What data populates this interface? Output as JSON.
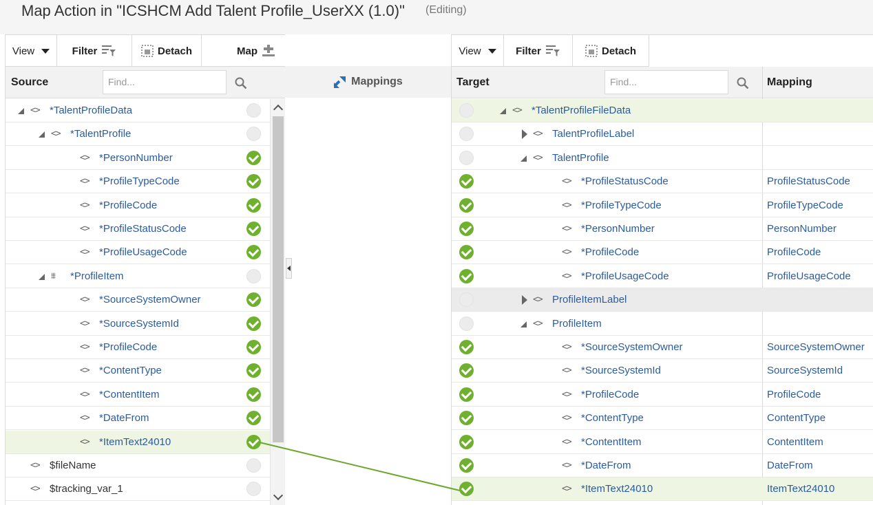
{
  "header": {
    "title": "Map Action in \"ICSHCM Add Talent Profile_UserXX (1.0)\"",
    "status": "(Editing)"
  },
  "source": {
    "toolbar": {
      "view": "View",
      "filter": "Filter",
      "detach": "Detach",
      "map": "Map"
    },
    "column_label": "Source",
    "find_placeholder": "Find...",
    "rows": [
      {
        "label": "*TalentProfileData",
        "status": "empty"
      },
      {
        "label": "*TalentProfile",
        "status": "empty"
      },
      {
        "label": "*PersonNumber",
        "status": "ok"
      },
      {
        "label": "*ProfileTypeCode",
        "status": "ok"
      },
      {
        "label": "*ProfileCode",
        "status": "ok"
      },
      {
        "label": "*ProfileStatusCode",
        "status": "ok"
      },
      {
        "label": "*ProfileUsageCode",
        "status": "ok"
      },
      {
        "label": "*ProfileItem",
        "status": "empty"
      },
      {
        "label": "*SourceSystemOwner",
        "status": "ok"
      },
      {
        "label": "*SourceSystemId",
        "status": "ok"
      },
      {
        "label": "*ProfileCode",
        "status": "ok"
      },
      {
        "label": "*ContentType",
        "status": "ok"
      },
      {
        "label": "*ContentItem",
        "status": "ok"
      },
      {
        "label": "*DateFrom",
        "status": "ok"
      },
      {
        "label": "*ItemText24010",
        "status": "ok",
        "selected": true
      },
      {
        "label": "$fileName",
        "status": "empty"
      },
      {
        "label": "$tracking_var_1",
        "status": "empty"
      }
    ]
  },
  "mappings": {
    "label": "Mappings"
  },
  "target": {
    "toolbar": {
      "view": "View",
      "filter": "Filter",
      "detach": "Detach"
    },
    "column_label": "Target",
    "mapping_label": "Mapping",
    "find_placeholder": "Find...",
    "rows": [
      {
        "label": "*TalentProfileFileData",
        "status": "empty",
        "mapping": ""
      },
      {
        "label": "TalentProfileLabel",
        "status": "empty",
        "mapping": ""
      },
      {
        "label": "TalentProfile",
        "status": "empty",
        "mapping": ""
      },
      {
        "label": "*ProfileStatusCode",
        "status": "ok",
        "mapping": "ProfileStatusCode"
      },
      {
        "label": "*ProfileTypeCode",
        "status": "ok",
        "mapping": "ProfileTypeCode"
      },
      {
        "label": "*PersonNumber",
        "status": "ok",
        "mapping": "PersonNumber"
      },
      {
        "label": "*ProfileCode",
        "status": "ok",
        "mapping": "ProfileCode"
      },
      {
        "label": "*ProfileUsageCode",
        "status": "ok",
        "mapping": "ProfileUsageCode"
      },
      {
        "label": "ProfileItemLabel",
        "status": "empty",
        "mapping": ""
      },
      {
        "label": "ProfileItem",
        "status": "empty",
        "mapping": ""
      },
      {
        "label": "*SourceSystemOwner",
        "status": "ok",
        "mapping": "SourceSystemOwner"
      },
      {
        "label": "*SourceSystemId",
        "status": "ok",
        "mapping": "SourceSystemId"
      },
      {
        "label": "*ProfileCode",
        "status": "ok",
        "mapping": "ProfileCode"
      },
      {
        "label": "*ContentType",
        "status": "ok",
        "mapping": "ContentType"
      },
      {
        "label": "*ContentItem",
        "status": "ok",
        "mapping": "ContentItem"
      },
      {
        "label": "*DateFrom",
        "status": "ok",
        "mapping": "DateFrom"
      },
      {
        "label": "*ItemText24010",
        "status": "ok",
        "mapping": "ItemText24010",
        "selected": true
      }
    ]
  },
  "colors": {
    "accent_link": "#2a5c9e",
    "ok_green": "#6fb02e",
    "connector": "#6aa72b",
    "selected_row": "#eef5e3"
  }
}
